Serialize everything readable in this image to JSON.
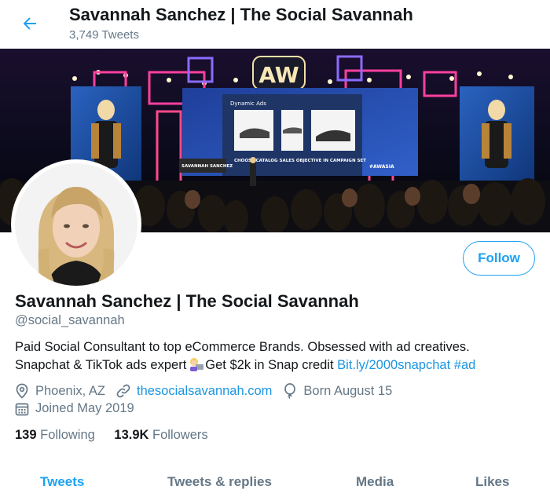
{
  "header": {
    "back_icon": "arrow-left-icon",
    "title": "Savannah Sanchez | The Social Savannah",
    "tweet_count": "3,749 Tweets"
  },
  "banner": {
    "logo_text": "AW",
    "screen_heading": "Dynamic Ads",
    "screen_caption": "CHOOSE CATALOG SALES OBJECTIVE IN CAMPAIGN SET",
    "nameplate": "SAVANNAH SANCHEZ",
    "hashtag": "#AWASIA"
  },
  "profile": {
    "name": "Savannah Sanchez | The Social Savannah",
    "handle": "@social_savannah",
    "follow_label": "Follow",
    "bio_line1": "Paid Social Consultant to top eCommerce Brands. Obsessed with ad creatives.",
    "bio_line2_text": "Snapchat & TikTok ads expert",
    "bio_emoji": "woman-technologist-emoji",
    "bio_line2_text_b": "Get $2k in Snap credit",
    "bio_link": "Bit.ly/2000snapchat",
    "bio_hashtag": "#ad",
    "location": "Phoenix, AZ",
    "website": "thesocialsavannah.com",
    "birthday": "Born August 15",
    "joined": "Joined May 2019",
    "following_count": "139",
    "following_label": "Following",
    "followers_count": "13.9K",
    "followers_label": "Followers"
  },
  "tabs": [
    {
      "label": "Tweets",
      "active": true
    },
    {
      "label": "Tweets & replies",
      "active": false
    },
    {
      "label": "Media",
      "active": false
    },
    {
      "label": "Likes",
      "active": false
    }
  ],
  "colors": {
    "accent": "#1da1f2",
    "link": "#1b95e0",
    "secondary_text": "#657786"
  }
}
